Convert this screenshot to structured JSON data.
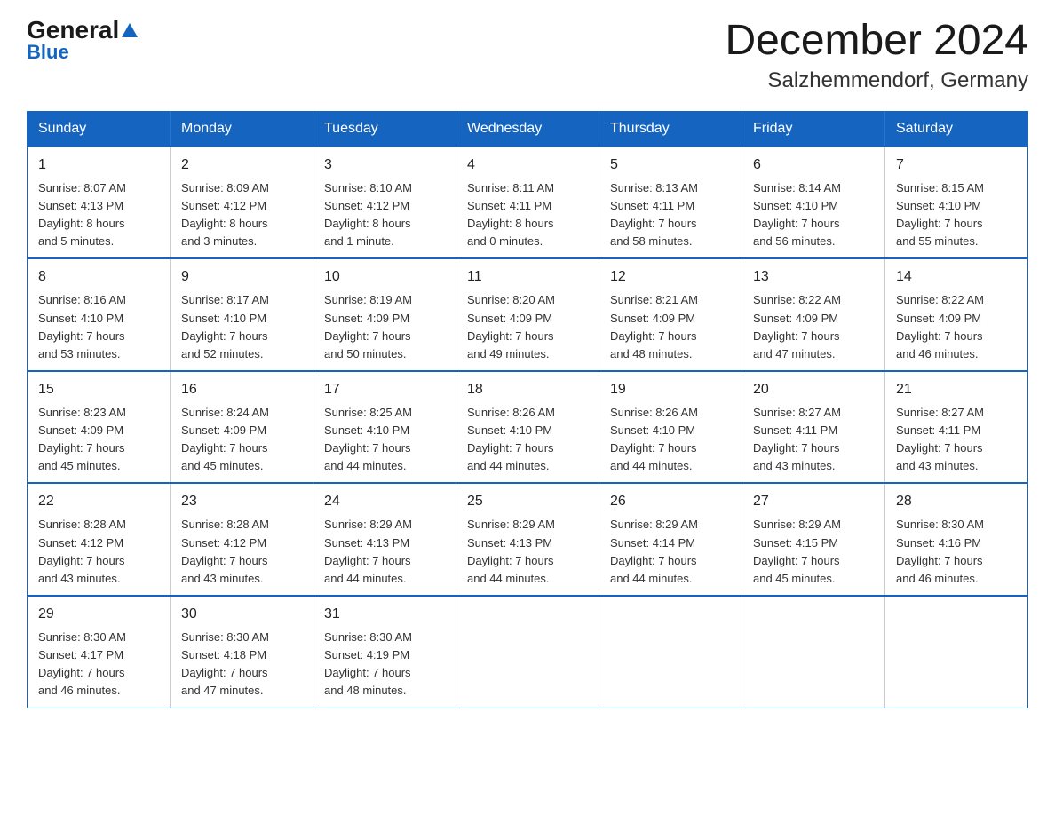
{
  "logo": {
    "general": "General",
    "blue": "Blue",
    "triangle": "▶"
  },
  "title": "December 2024",
  "subtitle": "Salzhemmendorf, Germany",
  "calendar": {
    "headers": [
      "Sunday",
      "Monday",
      "Tuesday",
      "Wednesday",
      "Thursday",
      "Friday",
      "Saturday"
    ],
    "weeks": [
      [
        {
          "day": "1",
          "info": "Sunrise: 8:07 AM\nSunset: 4:13 PM\nDaylight: 8 hours\nand 5 minutes."
        },
        {
          "day": "2",
          "info": "Sunrise: 8:09 AM\nSunset: 4:12 PM\nDaylight: 8 hours\nand 3 minutes."
        },
        {
          "day": "3",
          "info": "Sunrise: 8:10 AM\nSunset: 4:12 PM\nDaylight: 8 hours\nand 1 minute."
        },
        {
          "day": "4",
          "info": "Sunrise: 8:11 AM\nSunset: 4:11 PM\nDaylight: 8 hours\nand 0 minutes."
        },
        {
          "day": "5",
          "info": "Sunrise: 8:13 AM\nSunset: 4:11 PM\nDaylight: 7 hours\nand 58 minutes."
        },
        {
          "day": "6",
          "info": "Sunrise: 8:14 AM\nSunset: 4:10 PM\nDaylight: 7 hours\nand 56 minutes."
        },
        {
          "day": "7",
          "info": "Sunrise: 8:15 AM\nSunset: 4:10 PM\nDaylight: 7 hours\nand 55 minutes."
        }
      ],
      [
        {
          "day": "8",
          "info": "Sunrise: 8:16 AM\nSunset: 4:10 PM\nDaylight: 7 hours\nand 53 minutes."
        },
        {
          "day": "9",
          "info": "Sunrise: 8:17 AM\nSunset: 4:10 PM\nDaylight: 7 hours\nand 52 minutes."
        },
        {
          "day": "10",
          "info": "Sunrise: 8:19 AM\nSunset: 4:09 PM\nDaylight: 7 hours\nand 50 minutes."
        },
        {
          "day": "11",
          "info": "Sunrise: 8:20 AM\nSunset: 4:09 PM\nDaylight: 7 hours\nand 49 minutes."
        },
        {
          "day": "12",
          "info": "Sunrise: 8:21 AM\nSunset: 4:09 PM\nDaylight: 7 hours\nand 48 minutes."
        },
        {
          "day": "13",
          "info": "Sunrise: 8:22 AM\nSunset: 4:09 PM\nDaylight: 7 hours\nand 47 minutes."
        },
        {
          "day": "14",
          "info": "Sunrise: 8:22 AM\nSunset: 4:09 PM\nDaylight: 7 hours\nand 46 minutes."
        }
      ],
      [
        {
          "day": "15",
          "info": "Sunrise: 8:23 AM\nSunset: 4:09 PM\nDaylight: 7 hours\nand 45 minutes."
        },
        {
          "day": "16",
          "info": "Sunrise: 8:24 AM\nSunset: 4:09 PM\nDaylight: 7 hours\nand 45 minutes."
        },
        {
          "day": "17",
          "info": "Sunrise: 8:25 AM\nSunset: 4:10 PM\nDaylight: 7 hours\nand 44 minutes."
        },
        {
          "day": "18",
          "info": "Sunrise: 8:26 AM\nSunset: 4:10 PM\nDaylight: 7 hours\nand 44 minutes."
        },
        {
          "day": "19",
          "info": "Sunrise: 8:26 AM\nSunset: 4:10 PM\nDaylight: 7 hours\nand 44 minutes."
        },
        {
          "day": "20",
          "info": "Sunrise: 8:27 AM\nSunset: 4:11 PM\nDaylight: 7 hours\nand 43 minutes."
        },
        {
          "day": "21",
          "info": "Sunrise: 8:27 AM\nSunset: 4:11 PM\nDaylight: 7 hours\nand 43 minutes."
        }
      ],
      [
        {
          "day": "22",
          "info": "Sunrise: 8:28 AM\nSunset: 4:12 PM\nDaylight: 7 hours\nand 43 minutes."
        },
        {
          "day": "23",
          "info": "Sunrise: 8:28 AM\nSunset: 4:12 PM\nDaylight: 7 hours\nand 43 minutes."
        },
        {
          "day": "24",
          "info": "Sunrise: 8:29 AM\nSunset: 4:13 PM\nDaylight: 7 hours\nand 44 minutes."
        },
        {
          "day": "25",
          "info": "Sunrise: 8:29 AM\nSunset: 4:13 PM\nDaylight: 7 hours\nand 44 minutes."
        },
        {
          "day": "26",
          "info": "Sunrise: 8:29 AM\nSunset: 4:14 PM\nDaylight: 7 hours\nand 44 minutes."
        },
        {
          "day": "27",
          "info": "Sunrise: 8:29 AM\nSunset: 4:15 PM\nDaylight: 7 hours\nand 45 minutes."
        },
        {
          "day": "28",
          "info": "Sunrise: 8:30 AM\nSunset: 4:16 PM\nDaylight: 7 hours\nand 46 minutes."
        }
      ],
      [
        {
          "day": "29",
          "info": "Sunrise: 8:30 AM\nSunset: 4:17 PM\nDaylight: 7 hours\nand 46 minutes."
        },
        {
          "day": "30",
          "info": "Sunrise: 8:30 AM\nSunset: 4:18 PM\nDaylight: 7 hours\nand 47 minutes."
        },
        {
          "day": "31",
          "info": "Sunrise: 8:30 AM\nSunset: 4:19 PM\nDaylight: 7 hours\nand 48 minutes."
        },
        null,
        null,
        null,
        null
      ]
    ]
  }
}
